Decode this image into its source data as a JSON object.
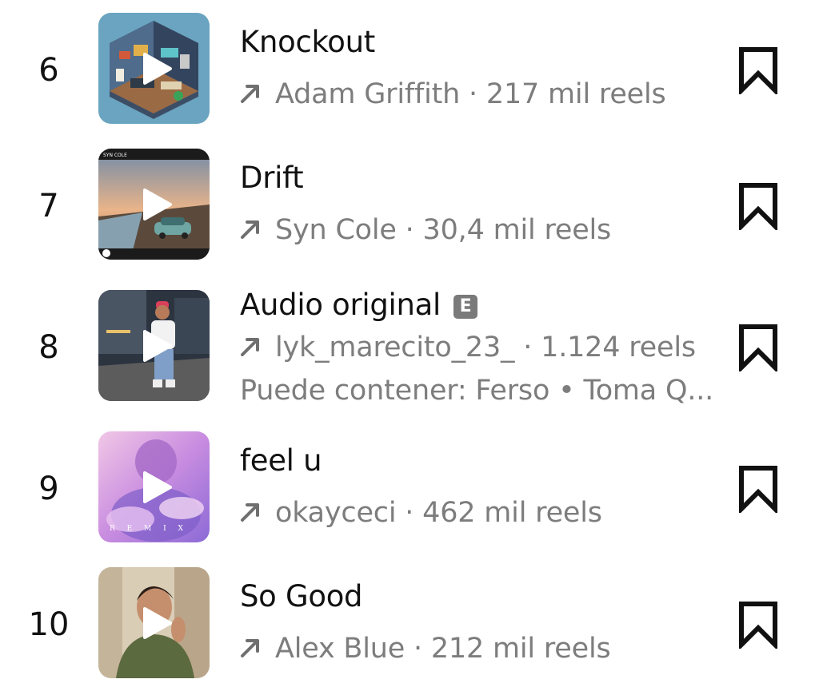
{
  "items": [
    {
      "rank": "6",
      "title": "Knockout",
      "artist": "Adam Griffith",
      "reels": " · 217 mil reels",
      "icon": "room-artwork"
    },
    {
      "rank": "7",
      "title": "Drift",
      "artist": "Syn Cole",
      "reels": " · 30,4 mil reels",
      "icon": "car-sunset-artwork",
      "art_text": "SYN COLE"
    },
    {
      "rank": "8",
      "title": "Audio original",
      "explicit": "E",
      "artist": "lyk_marecito_23_",
      "reels": " · 1.124 reels",
      "may_contain": "Puede contener: Ferso • Toma Q...",
      "icon": "street-person-artwork"
    },
    {
      "rank": "9",
      "title": "feel u",
      "artist": "okayceci",
      "reels": " · 462 mil reels",
      "icon": "pink-portrait-artwork",
      "art_text": "R E M I X"
    },
    {
      "rank": "10",
      "title": "So Good",
      "artist": "Alex Blue",
      "reels": " · 212 mil reels",
      "icon": "man-portrait-artwork"
    }
  ],
  "colors": {
    "text": "#111111",
    "secondary": "#7d7d7d",
    "explicit_badge": "#7a7a7a"
  }
}
